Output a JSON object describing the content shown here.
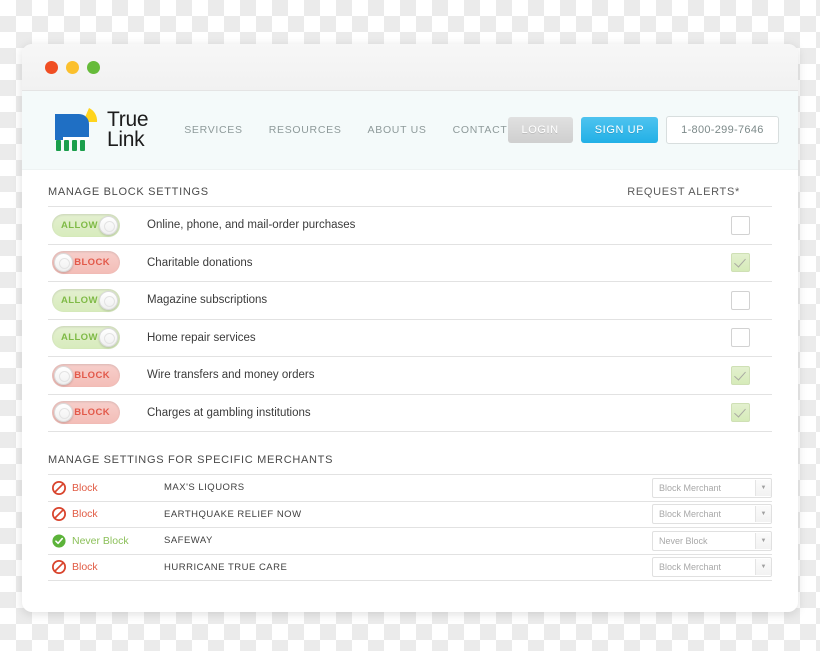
{
  "window": {
    "dots": [
      "close-red",
      "minimize-yellow",
      "maximize-green"
    ]
  },
  "header": {
    "logo_line1": "True",
    "logo_line2": "Link",
    "nav": [
      {
        "label": "SERVICES"
      },
      {
        "label": "RESOURCES"
      },
      {
        "label": "ABOUT US"
      },
      {
        "label": "CONTACT"
      }
    ],
    "login_label": "LOGIN",
    "signup_label": "SIGN UP",
    "phone": "1-800-299-7646",
    "colors": {
      "signup": "#22b0e6",
      "login": "#cfcfcf",
      "band": "#f4fafa"
    }
  },
  "block_settings": {
    "title": "MANAGE BLOCK SETTINGS",
    "alerts_header": "REQUEST ALERTS*",
    "rows": [
      {
        "toggle": "ALLOW",
        "state": "allow",
        "label": "Online, phone, and mail-order purchases",
        "alert_checked": false
      },
      {
        "toggle": "BLOCK",
        "state": "block",
        "label": "Charitable donations",
        "alert_checked": true
      },
      {
        "toggle": "ALLOW",
        "state": "allow",
        "label": "Magazine subscriptions",
        "alert_checked": false
      },
      {
        "toggle": "ALLOW",
        "state": "allow",
        "label": "Home repair services",
        "alert_checked": false
      },
      {
        "toggle": "BLOCK",
        "state": "block",
        "label": "Wire transfers and money orders",
        "alert_checked": true
      },
      {
        "toggle": "BLOCK",
        "state": "block",
        "label": "Charges at gambling institutions",
        "alert_checked": true
      }
    ]
  },
  "merchant_settings": {
    "title": "MANAGE SETTINGS FOR SPECIFIC MERCHANTS",
    "rows": [
      {
        "status": "Block",
        "status_type": "block",
        "name": "MAX'S LIQUORS",
        "select_value": "Block Merchant"
      },
      {
        "status": "Block",
        "status_type": "block",
        "name": "EARTHQUAKE RELIEF NOW",
        "select_value": "Block Merchant"
      },
      {
        "status": "Never Block",
        "status_type": "never",
        "name": "SAFEWAY",
        "select_value": "Never Block"
      },
      {
        "status": "Block",
        "status_type": "block",
        "name": "HURRICANE TRUE CARE",
        "select_value": "Block Merchant"
      }
    ]
  }
}
